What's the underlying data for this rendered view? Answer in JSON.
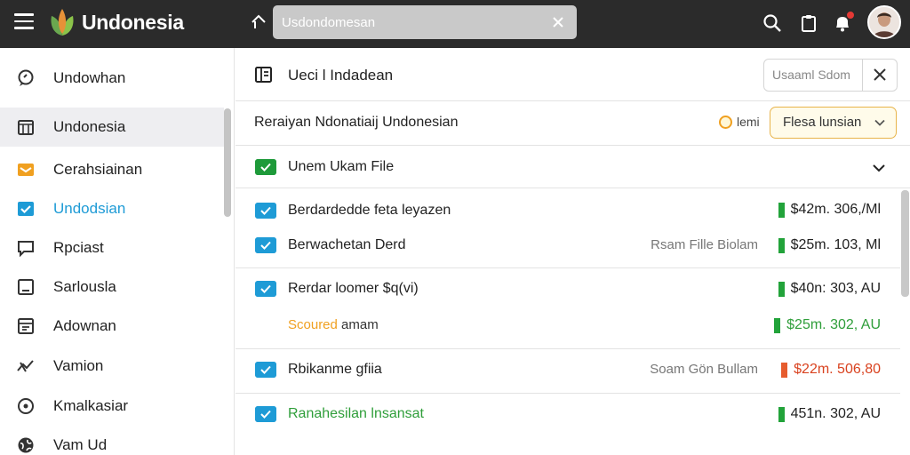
{
  "app": {
    "name": "Undonesia",
    "search_placeholder": "Usdondomesan"
  },
  "sidebar": {
    "items": [
      {
        "label": "Undowhan",
        "icon": "chat-icon"
      },
      {
        "label": "Undonesia",
        "icon": "calendar-icon",
        "active": true
      },
      {
        "label": "Cerahsiainan",
        "icon": "mail-icon"
      },
      {
        "label": "Undodsian",
        "icon": "checkbox-icon"
      },
      {
        "label": "Rpciast",
        "icon": "message-icon"
      },
      {
        "label": "Sarlousla",
        "icon": "frame-icon"
      },
      {
        "label": "Adownan",
        "icon": "table-icon"
      },
      {
        "label": "Vamion",
        "icon": "activity-icon"
      },
      {
        "label": "Kmalkasiar",
        "icon": "target-icon"
      },
      {
        "label": "Vam Ud",
        "icon": "globe-icon"
      }
    ]
  },
  "main": {
    "header_title": "Ueci l Indadean",
    "header_search_placeholder": "Usaaml Sdom",
    "subheader_title": "Reraiyan Ndonatiaij Undonesian",
    "filter_tag": "lemi",
    "filter_select": "Flesa lunsian",
    "group_label": "Unem Ukam File",
    "rows": [
      {
        "label": "Berdardedde feta leyazen",
        "meta": "",
        "amount": "$42m. 306,/Ml"
      },
      {
        "label": "Berwachetan Derd",
        "meta": "Rsam Fille Biolam",
        "amount": "$25m. 103, Ml"
      },
      {
        "label": "Rerdar loomer $q(vi)",
        "meta": "",
        "amount": "$40n: 303, AU"
      },
      {
        "label_accent": "Scoured",
        "label_rest": " amam",
        "meta": "",
        "amount": "$25m. 302, AU"
      },
      {
        "label": "Rbikanme gfiia",
        "meta": "Soam Gön Bullam",
        "amount": "$22m. 506,80"
      },
      {
        "label": "Ranahesilan lnsansat",
        "meta": "",
        "amount": "451n. 302, AU"
      }
    ]
  },
  "colors": {
    "topbar": "#2b2b2b",
    "accent_blue": "#1e9bd6",
    "accent_green": "#1e9a3a",
    "accent_orange": "#f0a020",
    "accent_red": "#d9421f"
  }
}
